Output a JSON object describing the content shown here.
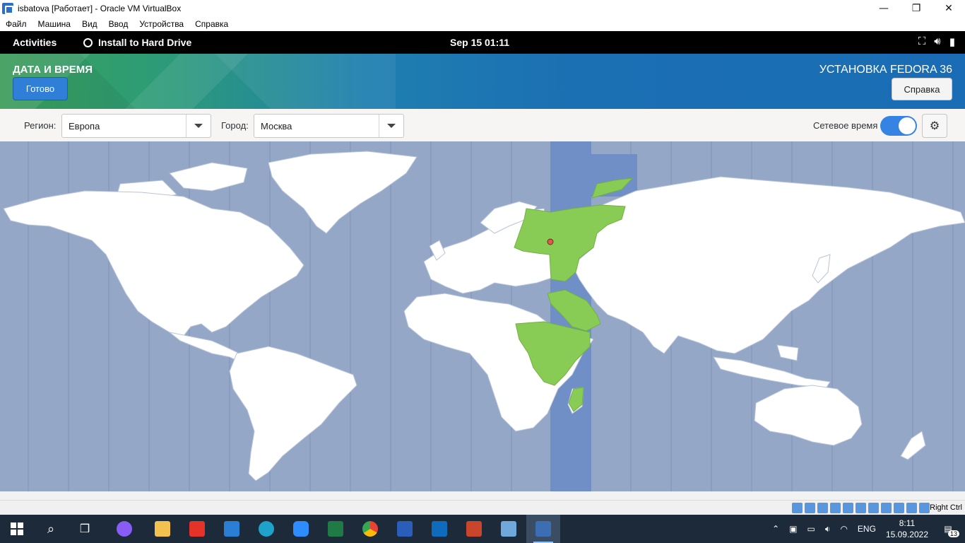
{
  "window": {
    "title": "isbatova [Работает] - Oracle VM VirtualBox",
    "controls": [
      "—",
      "❐",
      "✕"
    ],
    "menu": [
      "Файл",
      "Машина",
      "Вид",
      "Ввод",
      "Устройства",
      "Справка"
    ]
  },
  "gnome": {
    "activities": "Activities",
    "app_name": "Install to Hard Drive",
    "clock": "Sep 15  01:11",
    "tray_icons": [
      "network-icon",
      "volume-icon",
      "battery-icon"
    ]
  },
  "header": {
    "spoke_title": "ДАТА И ВРЕМЯ",
    "done_label": "Готово",
    "product_title": "УСТАНОВКА FEDORA 36",
    "help_label": "Справка"
  },
  "controls": {
    "region_label": "Регион:",
    "region_value": "Европа",
    "city_label": "Город:",
    "city_value": "Москва",
    "network_time_label": "Сетевое время",
    "network_time_enabled": true
  },
  "map": {
    "selected_timezone": "Europe/Moscow",
    "colors": {
      "ocean": "#94a7c7",
      "land": "#ffffff",
      "highlight_land": "#88cc55",
      "highlight_band": "#6f8fc6"
    }
  },
  "vb_status": {
    "host_key": "Right Ctrl"
  },
  "taskbar": {
    "apps": [
      "start",
      "search",
      "task-view",
      "alice",
      "explorer",
      "yandex",
      "mail",
      "edge",
      "zoom",
      "excel",
      "chrome",
      "word",
      "outlook",
      "powerpoint",
      "virtualbox",
      "fedora-vm"
    ],
    "lang": "ENG",
    "time": "8:11",
    "date": "15.09.2022",
    "notifications": "13"
  }
}
